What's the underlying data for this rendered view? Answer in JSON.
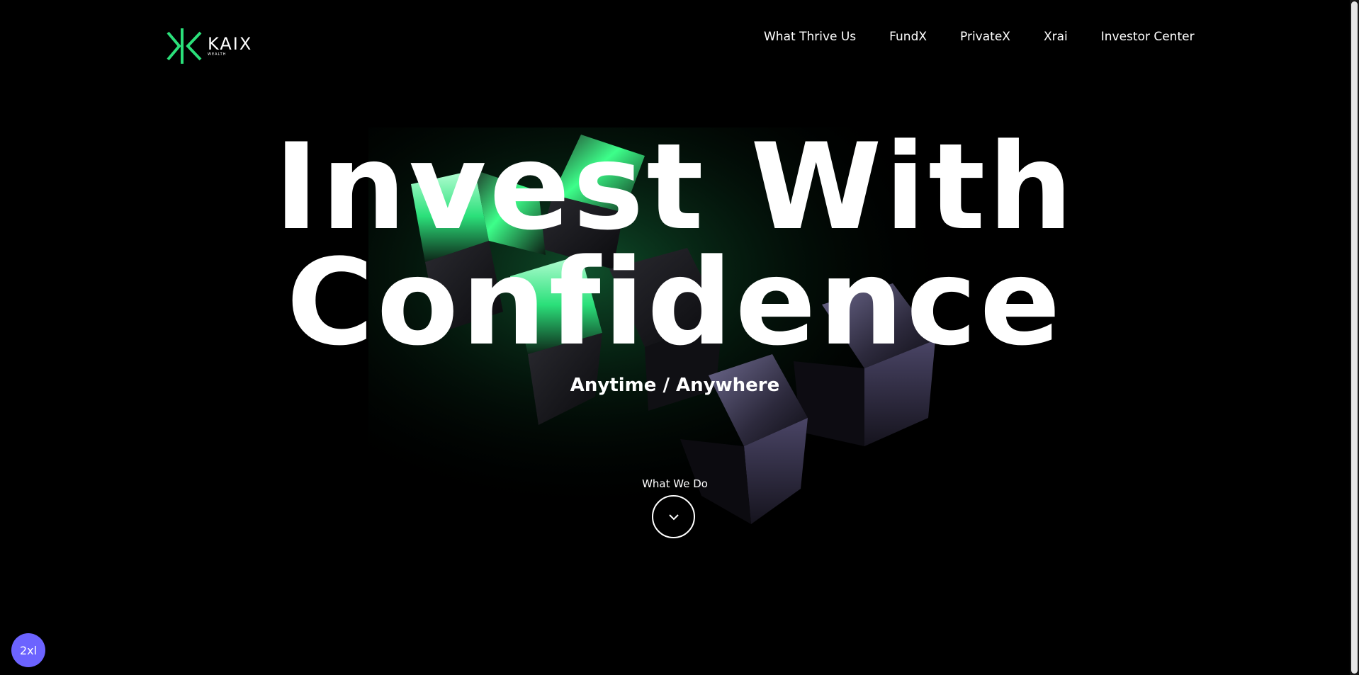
{
  "brand": {
    "name": "KAIX",
    "subtitle": "WEALTH",
    "accent_color": "#2BE07A"
  },
  "nav": {
    "items": [
      {
        "label": "What Thrive Us"
      },
      {
        "label": "FundX"
      },
      {
        "label": "PrivateX"
      },
      {
        "label": "Xrai"
      },
      {
        "label": "Investor Center"
      }
    ]
  },
  "hero": {
    "title_line1": "Invest With",
    "title_line2": "Confidence",
    "tagline": "Anytime / Anywhere",
    "scroll_label": "What We Do",
    "scroll_icon": "chevron-down-icon"
  },
  "debug": {
    "breakpoint": "2xl",
    "badge_color": "#6C63FF"
  }
}
